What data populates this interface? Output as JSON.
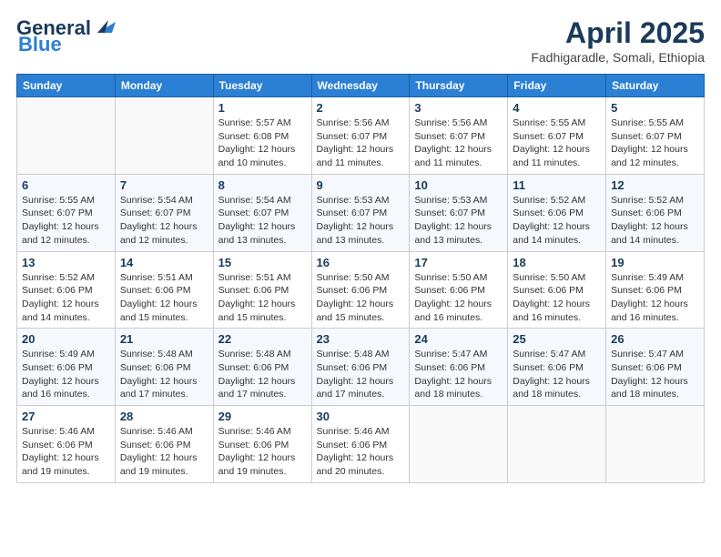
{
  "logo": {
    "line1": "General",
    "line2": "Blue"
  },
  "title": "April 2025",
  "subtitle": "Fadhigaradle, Somali, Ethiopia",
  "days_of_week": [
    "Sunday",
    "Monday",
    "Tuesday",
    "Wednesday",
    "Thursday",
    "Friday",
    "Saturday"
  ],
  "weeks": [
    [
      {
        "day": "",
        "info": ""
      },
      {
        "day": "",
        "info": ""
      },
      {
        "day": "1",
        "info": "Sunrise: 5:57 AM\nSunset: 6:08 PM\nDaylight: 12 hours and 10 minutes."
      },
      {
        "day": "2",
        "info": "Sunrise: 5:56 AM\nSunset: 6:07 PM\nDaylight: 12 hours and 11 minutes."
      },
      {
        "day": "3",
        "info": "Sunrise: 5:56 AM\nSunset: 6:07 PM\nDaylight: 12 hours and 11 minutes."
      },
      {
        "day": "4",
        "info": "Sunrise: 5:55 AM\nSunset: 6:07 PM\nDaylight: 12 hours and 11 minutes."
      },
      {
        "day": "5",
        "info": "Sunrise: 5:55 AM\nSunset: 6:07 PM\nDaylight: 12 hours and 12 minutes."
      }
    ],
    [
      {
        "day": "6",
        "info": "Sunrise: 5:55 AM\nSunset: 6:07 PM\nDaylight: 12 hours and 12 minutes."
      },
      {
        "day": "7",
        "info": "Sunrise: 5:54 AM\nSunset: 6:07 PM\nDaylight: 12 hours and 12 minutes."
      },
      {
        "day": "8",
        "info": "Sunrise: 5:54 AM\nSunset: 6:07 PM\nDaylight: 12 hours and 13 minutes."
      },
      {
        "day": "9",
        "info": "Sunrise: 5:53 AM\nSunset: 6:07 PM\nDaylight: 12 hours and 13 minutes."
      },
      {
        "day": "10",
        "info": "Sunrise: 5:53 AM\nSunset: 6:07 PM\nDaylight: 12 hours and 13 minutes."
      },
      {
        "day": "11",
        "info": "Sunrise: 5:52 AM\nSunset: 6:06 PM\nDaylight: 12 hours and 14 minutes."
      },
      {
        "day": "12",
        "info": "Sunrise: 5:52 AM\nSunset: 6:06 PM\nDaylight: 12 hours and 14 minutes."
      }
    ],
    [
      {
        "day": "13",
        "info": "Sunrise: 5:52 AM\nSunset: 6:06 PM\nDaylight: 12 hours and 14 minutes."
      },
      {
        "day": "14",
        "info": "Sunrise: 5:51 AM\nSunset: 6:06 PM\nDaylight: 12 hours and 15 minutes."
      },
      {
        "day": "15",
        "info": "Sunrise: 5:51 AM\nSunset: 6:06 PM\nDaylight: 12 hours and 15 minutes."
      },
      {
        "day": "16",
        "info": "Sunrise: 5:50 AM\nSunset: 6:06 PM\nDaylight: 12 hours and 15 minutes."
      },
      {
        "day": "17",
        "info": "Sunrise: 5:50 AM\nSunset: 6:06 PM\nDaylight: 12 hours and 16 minutes."
      },
      {
        "day": "18",
        "info": "Sunrise: 5:50 AM\nSunset: 6:06 PM\nDaylight: 12 hours and 16 minutes."
      },
      {
        "day": "19",
        "info": "Sunrise: 5:49 AM\nSunset: 6:06 PM\nDaylight: 12 hours and 16 minutes."
      }
    ],
    [
      {
        "day": "20",
        "info": "Sunrise: 5:49 AM\nSunset: 6:06 PM\nDaylight: 12 hours and 16 minutes."
      },
      {
        "day": "21",
        "info": "Sunrise: 5:48 AM\nSunset: 6:06 PM\nDaylight: 12 hours and 17 minutes."
      },
      {
        "day": "22",
        "info": "Sunrise: 5:48 AM\nSunset: 6:06 PM\nDaylight: 12 hours and 17 minutes."
      },
      {
        "day": "23",
        "info": "Sunrise: 5:48 AM\nSunset: 6:06 PM\nDaylight: 12 hours and 17 minutes."
      },
      {
        "day": "24",
        "info": "Sunrise: 5:47 AM\nSunset: 6:06 PM\nDaylight: 12 hours and 18 minutes."
      },
      {
        "day": "25",
        "info": "Sunrise: 5:47 AM\nSunset: 6:06 PM\nDaylight: 12 hours and 18 minutes."
      },
      {
        "day": "26",
        "info": "Sunrise: 5:47 AM\nSunset: 6:06 PM\nDaylight: 12 hours and 18 minutes."
      }
    ],
    [
      {
        "day": "27",
        "info": "Sunrise: 5:46 AM\nSunset: 6:06 PM\nDaylight: 12 hours and 19 minutes."
      },
      {
        "day": "28",
        "info": "Sunrise: 5:46 AM\nSunset: 6:06 PM\nDaylight: 12 hours and 19 minutes."
      },
      {
        "day": "29",
        "info": "Sunrise: 5:46 AM\nSunset: 6:06 PM\nDaylight: 12 hours and 19 minutes."
      },
      {
        "day": "30",
        "info": "Sunrise: 5:46 AM\nSunset: 6:06 PM\nDaylight: 12 hours and 20 minutes."
      },
      {
        "day": "",
        "info": ""
      },
      {
        "day": "",
        "info": ""
      },
      {
        "day": "",
        "info": ""
      }
    ]
  ]
}
